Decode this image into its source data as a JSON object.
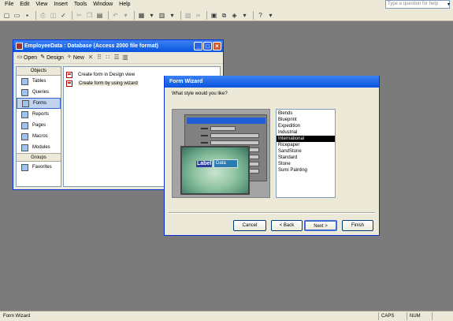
{
  "menu": [
    "File",
    "Edit",
    "View",
    "Insert",
    "Tools",
    "Window",
    "Help"
  ],
  "help_search": {
    "placeholder": "Type a question for help"
  },
  "db_window": {
    "title": "EmployeeData : Database (Access 2000 file format)",
    "toolbar": {
      "open": "Open",
      "design": "Design",
      "new": "New"
    },
    "objects_header": "Objects",
    "objects": [
      "Tables",
      "Queries",
      "Forms",
      "Reports",
      "Pages",
      "Macros",
      "Modules"
    ],
    "selected_object": "Forms",
    "groups_header": "Groups",
    "favorites": "Favorites",
    "list_items": [
      "Create form in Design view",
      "Create form by using wizard"
    ]
  },
  "wizard": {
    "title": "Form Wizard",
    "question": "What style would you like?",
    "preview": {
      "label_text": "Label",
      "data_text": "Data"
    },
    "styles": [
      "Blends",
      "Blueprint",
      "Expedition",
      "Industrial",
      "International",
      "Ricepaper",
      "SandStone",
      "Standard",
      "Stone",
      "Sumi Painting"
    ],
    "selected_style": "International",
    "buttons": {
      "cancel": "Cancel",
      "back": "< Back",
      "next": "Next >",
      "finish": "Finish"
    }
  },
  "status": {
    "text": "Form Wizard",
    "caps": "CAPS",
    "num": "NUM"
  }
}
